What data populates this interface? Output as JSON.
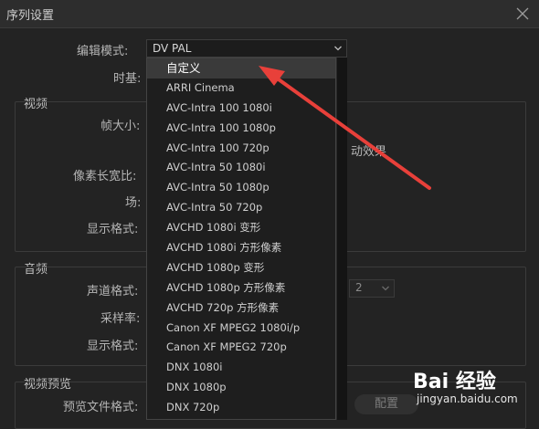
{
  "window": {
    "title": "序列设置"
  },
  "general": {
    "edit_mode_label": "编辑模式:",
    "edit_mode_value": "DV PAL",
    "timebase_label": "时基:"
  },
  "video": {
    "section_title": "视频",
    "frame_size_label": "帧大小:",
    "pixel_aspect_label": "像素长宽比:",
    "field_label": "场:",
    "display_format_label": "显示格式:",
    "partial_motion_text": "动效果"
  },
  "audio": {
    "section_title": "音频",
    "channel_format_label": "声道格式:",
    "sample_rate_label": "采样率:",
    "display_format_label": "显示格式:",
    "channels_value": "2"
  },
  "preview": {
    "section_title": "视频预览",
    "file_format_label": "预览文件格式:",
    "config_button": "配置"
  },
  "dropdown": {
    "items": [
      "自定义",
      "ARRI Cinema",
      "AVC-Intra 100 1080i",
      "AVC-Intra 100 1080p",
      "AVC-Intra 100 720p",
      "AVC-Intra 50 1080i",
      "AVC-Intra 50 1080p",
      "AVC-Intra 50 720p",
      "AVCHD 1080i 变形",
      "AVCHD 1080i 方形像素",
      "AVCHD 1080p 变形",
      "AVCHD 1080p 方形像素",
      "AVCHD 720p 方形像素",
      "Canon XF MPEG2 1080i/p",
      "Canon XF MPEG2 720p",
      "DNX 1080i",
      "DNX 1080p",
      "DNX 720p"
    ]
  },
  "watermark": {
    "logo": "Bai 经验",
    "url": "jingyan.baidu.com"
  },
  "colors": {
    "background": "#232323",
    "annotation_arrow": "#e8403a",
    "highlight": "#3a3a3a"
  }
}
